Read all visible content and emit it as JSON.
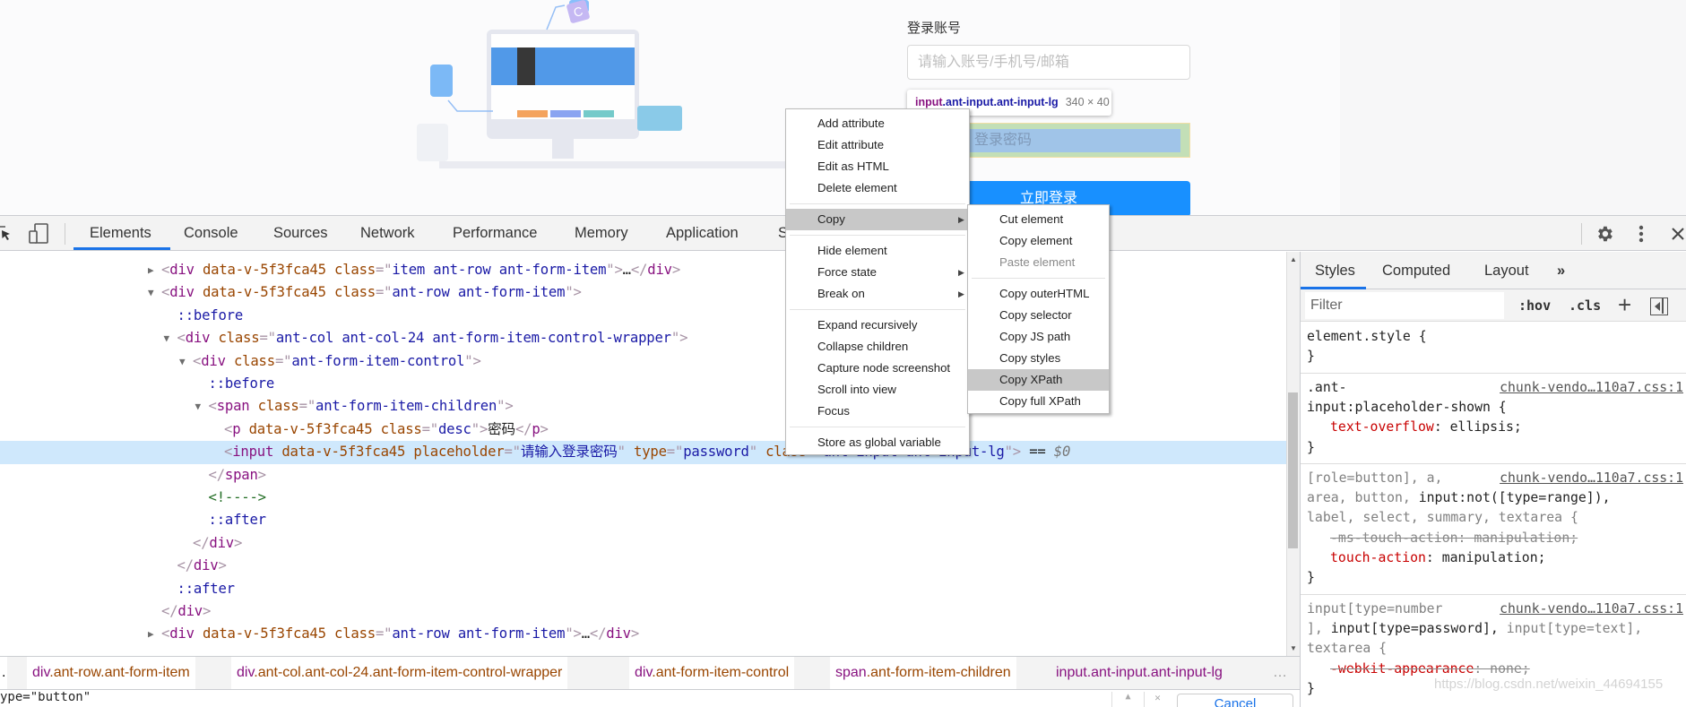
{
  "page": {
    "account_label": "登录账号",
    "account_placeholder": "请输入账号/手机号/邮箱",
    "password_placeholder_visible": "登录密码",
    "login_button": "立即登录",
    "illustration_letter": "C",
    "inspect_tooltip": {
      "tag": "input",
      "classes": ".ant-input.ant-input-lg",
      "size": "340 × 40"
    }
  },
  "toolbar": {
    "tabs": [
      "Elements",
      "Console",
      "Sources",
      "Network",
      "Performance",
      "Memory",
      "Application",
      "S"
    ],
    "active_tab": "Elements",
    "accent": "#1a73e8"
  },
  "elements": {
    "rows": [
      {
        "level": 0,
        "arrow": "collapsed",
        "tokens": [
          [
            "p",
            "<"
          ],
          [
            "tag",
            "div"
          ],
          [
            "txt",
            " "
          ],
          [
            "attr",
            "data-v-5f3fca45"
          ],
          [
            "txt",
            " "
          ],
          [
            "attr",
            "class"
          ],
          [
            "p",
            "=\""
          ],
          [
            "val",
            "item ant-row ant-form-item"
          ],
          [
            "p",
            "\">"
          ],
          [
            "txt",
            "…"
          ],
          [
            "p",
            "</"
          ],
          [
            "tag",
            "div"
          ],
          [
            "p",
            ">"
          ]
        ]
      },
      {
        "level": 0,
        "arrow": "expanded",
        "tokens": [
          [
            "p",
            "<"
          ],
          [
            "tag",
            "div"
          ],
          [
            "txt",
            " "
          ],
          [
            "attr",
            "data-v-5f3fca45"
          ],
          [
            "txt",
            " "
          ],
          [
            "attr",
            "class"
          ],
          [
            "p",
            "=\""
          ],
          [
            "val",
            "ant-row ant-form-item"
          ],
          [
            "p",
            "\">"
          ]
        ]
      },
      {
        "level": 1,
        "arrow": "none",
        "tokens": [
          [
            "pseudo",
            "::before"
          ]
        ]
      },
      {
        "level": 1,
        "arrow": "expanded",
        "tokens": [
          [
            "p",
            "<"
          ],
          [
            "tag",
            "div"
          ],
          [
            "txt",
            " "
          ],
          [
            "attr",
            "class"
          ],
          [
            "p",
            "=\""
          ],
          [
            "val",
            "ant-col ant-col-24 ant-form-item-control-wrapper"
          ],
          [
            "p",
            "\">"
          ]
        ]
      },
      {
        "level": 2,
        "arrow": "expanded",
        "tokens": [
          [
            "p",
            "<"
          ],
          [
            "tag",
            "div"
          ],
          [
            "txt",
            " "
          ],
          [
            "attr",
            "class"
          ],
          [
            "p",
            "=\""
          ],
          [
            "val",
            "ant-form-item-control"
          ],
          [
            "p",
            "\">"
          ]
        ]
      },
      {
        "level": 3,
        "arrow": "none",
        "tokens": [
          [
            "pseudo",
            "::before"
          ]
        ]
      },
      {
        "level": 3,
        "arrow": "expanded",
        "tokens": [
          [
            "p",
            "<"
          ],
          [
            "tag",
            "span"
          ],
          [
            "txt",
            " "
          ],
          [
            "attr",
            "class"
          ],
          [
            "p",
            "=\""
          ],
          [
            "val",
            "ant-form-item-children"
          ],
          [
            "p",
            "\">"
          ]
        ]
      },
      {
        "level": 4,
        "arrow": "none",
        "tokens": [
          [
            "p",
            "<"
          ],
          [
            "tag",
            "p"
          ],
          [
            "txt",
            " "
          ],
          [
            "attr",
            "data-v-5f3fca45"
          ],
          [
            "txt",
            " "
          ],
          [
            "attr",
            "class"
          ],
          [
            "p",
            "=\""
          ],
          [
            "val",
            "desc"
          ],
          [
            "p",
            "\">"
          ],
          [
            "txt",
            "密码"
          ],
          [
            "p",
            "</"
          ],
          [
            "tag",
            "p"
          ],
          [
            "p",
            ">"
          ]
        ]
      },
      {
        "level": 4,
        "arrow": "none",
        "selected": true,
        "tokens": [
          [
            "p",
            "<"
          ],
          [
            "tag",
            "input"
          ],
          [
            "txt",
            " "
          ],
          [
            "attr",
            "data-v-5f3fca45"
          ],
          [
            "txt",
            " "
          ],
          [
            "attr",
            "placeholder"
          ],
          [
            "p",
            "=\""
          ],
          [
            "val",
            "请输入登录密码"
          ],
          [
            "p",
            "\""
          ],
          [
            "txt",
            " "
          ],
          [
            "attr",
            "type"
          ],
          [
            "p",
            "=\""
          ],
          [
            "val",
            "password"
          ],
          [
            "p",
            "\""
          ],
          [
            "txt",
            " "
          ],
          [
            "attr",
            "class"
          ],
          [
            "p",
            "=\""
          ],
          [
            "val",
            "ant-input ant-input-lg"
          ],
          [
            "p",
            "\">"
          ],
          [
            "txt",
            " == "
          ],
          [
            "dim",
            "$0"
          ]
        ]
      },
      {
        "level": 3,
        "arrow": "none",
        "tokens": [
          [
            "p",
            "</"
          ],
          [
            "tag",
            "span"
          ],
          [
            "p",
            ">"
          ]
        ]
      },
      {
        "level": 3,
        "arrow": "none",
        "tokens": [
          [
            "com",
            "<!---->"
          ]
        ]
      },
      {
        "level": 3,
        "arrow": "none",
        "tokens": [
          [
            "pseudo",
            "::after"
          ]
        ]
      },
      {
        "level": 2,
        "arrow": "none",
        "tokens": [
          [
            "p",
            "</"
          ],
          [
            "tag",
            "div"
          ],
          [
            "p",
            ">"
          ]
        ]
      },
      {
        "level": 1,
        "arrow": "none",
        "tokens": [
          [
            "p",
            "</"
          ],
          [
            "tag",
            "div"
          ],
          [
            "p",
            ">"
          ]
        ]
      },
      {
        "level": 1,
        "arrow": "none",
        "tokens": [
          [
            "pseudo",
            "::after"
          ]
        ]
      },
      {
        "level": 0,
        "arrow": "none",
        "tokens": [
          [
            "p",
            "</"
          ],
          [
            "tag",
            "div"
          ],
          [
            "p",
            ">"
          ]
        ]
      },
      {
        "level": 0,
        "arrow": "collapsed",
        "tokens": [
          [
            "p",
            "<"
          ],
          [
            "tag",
            "div"
          ],
          [
            "txt",
            " "
          ],
          [
            "attr",
            "data-v-5f3fca45"
          ],
          [
            "txt",
            " "
          ],
          [
            "attr",
            "class"
          ],
          [
            "p",
            "=\""
          ],
          [
            "val",
            "ant-row ant-form-item"
          ],
          [
            "p",
            "\">"
          ],
          [
            "txt",
            "…"
          ],
          [
            "p",
            "</"
          ],
          [
            "tag",
            "div"
          ],
          [
            "p",
            ">"
          ]
        ]
      }
    ]
  },
  "breadcrumbs": [
    {
      "tag": "div",
      "cls": ".ant-row.ant-form-item"
    },
    {
      "tag": "div",
      "cls": ".ant-col.ant-col-24.ant-form-item-control-wrapper"
    },
    {
      "tag": "div",
      "cls": ".ant-form-item-control"
    },
    {
      "tag": "span",
      "cls": ".ant-form-item-children"
    },
    {
      "tag": "input",
      "cls": ".ant-input.ant-input-lg",
      "selected": true
    }
  ],
  "breadcrumb_more": "…",
  "search_bar": {
    "value": "ype=\"button\"",
    "cancel": "Cancel"
  },
  "styles_pane": {
    "tabs": [
      "Styles",
      "Computed",
      "Layout",
      "»"
    ],
    "active_tab": "Styles",
    "filter_placeholder": "Filter",
    "hov": ":hov",
    "cls": ".cls",
    "rules": [
      {
        "lines": [
          [
            [
              "sel",
              "element.style {"
            ]
          ],
          [
            [
              "sel",
              "}"
            ]
          ]
        ]
      },
      {
        "source": "chunk-vendo…110a7.css:1",
        "lines": [
          [
            [
              "sel",
              ".ant-"
            ]
          ],
          [
            [
              "sel",
              "input:placeholder-shown {"
            ]
          ],
          [
            [
              "ind",
              ""
            ],
            [
              "prop",
              "text-overflow"
            ],
            [
              "sel",
              ": ellipsis;"
            ]
          ],
          [
            [
              "sel",
              "}"
            ]
          ]
        ]
      },
      {
        "source": "chunk-vendo…110a7.css:1",
        "lines": [
          [
            [
              "dim",
              "[role=button], a,"
            ]
          ],
          [
            [
              "dim",
              "area, button, "
            ],
            [
              "sel",
              "input:not([type=range]),"
            ]
          ],
          [
            [
              "dim",
              "label, select, summary, textarea {"
            ]
          ],
          [
            [
              "ind",
              ""
            ],
            [
              "strike",
              "-ms-touch-action: manipulation;"
            ]
          ],
          [
            [
              "ind",
              ""
            ],
            [
              "prop",
              "touch-action"
            ],
            [
              "sel",
              ": manipulation;"
            ]
          ],
          [
            [
              "sel",
              "}"
            ]
          ]
        ]
      },
      {
        "source": "chunk-vendo…110a7.css:1",
        "lines": [
          [
            [
              "dim",
              "input[type=number"
            ]
          ],
          [
            [
              "dim",
              "], "
            ],
            [
              "sel",
              "input[type=password], "
            ],
            [
              "dim",
              "input[type=text],"
            ]
          ],
          [
            [
              "dim",
              "textarea {"
            ]
          ],
          [
            [
              "ind",
              ""
            ],
            [
              "strikeprop",
              "-webkit-appearance"
            ],
            [
              "strike",
              ": none;"
            ]
          ],
          [
            [
              "sel",
              "}"
            ]
          ]
        ]
      }
    ]
  },
  "watermark": "https://blog.csdn.net/weixin_44694155",
  "context_menu": {
    "items": [
      {
        "label": "Add attribute"
      },
      {
        "label": "Edit attribute"
      },
      {
        "label": "Edit as HTML"
      },
      {
        "label": "Delete element"
      },
      {
        "sep": true
      },
      {
        "label": "Copy",
        "submenu": true,
        "highlighted": true
      },
      {
        "sep": true
      },
      {
        "label": "Hide element"
      },
      {
        "label": "Force state",
        "submenu": true
      },
      {
        "label": "Break on",
        "submenu": true
      },
      {
        "sep": true
      },
      {
        "label": "Expand recursively"
      },
      {
        "label": "Collapse children"
      },
      {
        "label": "Capture node screenshot"
      },
      {
        "label": "Scroll into view"
      },
      {
        "label": "Focus"
      },
      {
        "sep": true
      },
      {
        "label": "Store as global variable"
      }
    ]
  },
  "copy_submenu": {
    "items": [
      {
        "label": "Cut element"
      },
      {
        "label": "Copy element"
      },
      {
        "label": "Paste element",
        "disabled": true
      },
      {
        "sep": true
      },
      {
        "label": "Copy outerHTML"
      },
      {
        "label": "Copy selector"
      },
      {
        "label": "Copy JS path"
      },
      {
        "label": "Copy styles"
      },
      {
        "label": "Copy XPath",
        "highlighted": true
      },
      {
        "label": "Copy full XPath"
      }
    ]
  }
}
